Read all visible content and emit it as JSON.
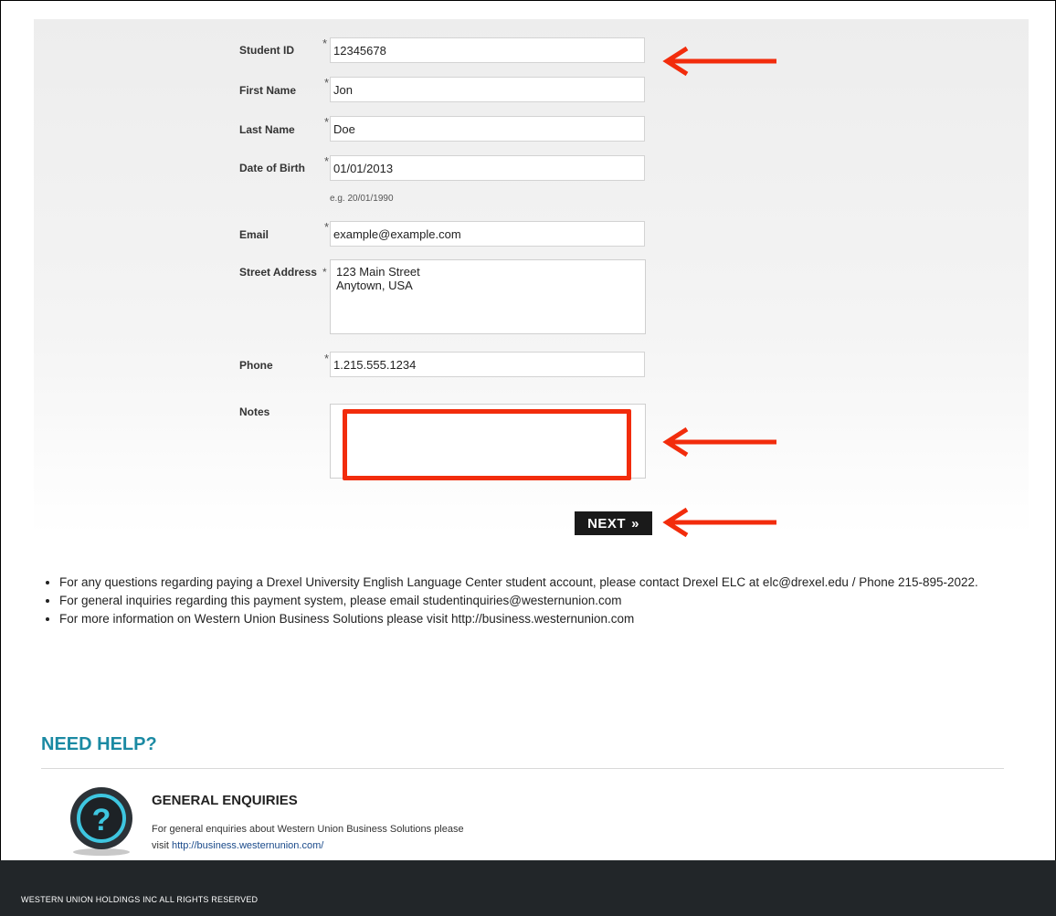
{
  "form": {
    "student_id": {
      "label": "Student ID",
      "value": "12345678"
    },
    "first_name": {
      "label": "First Name",
      "value": "Jon"
    },
    "last_name": {
      "label": "Last Name",
      "value": "Doe"
    },
    "dob": {
      "label": "Date of Birth",
      "value": "01/01/2013",
      "hint": "e.g. 20/01/1990"
    },
    "email": {
      "label": "Email",
      "value": "example@example.com"
    },
    "street": {
      "label": "Street Address",
      "value": "123 Main Street\nAnytown, USA"
    },
    "phone": {
      "label": "Phone",
      "value": "1.215.555.1234"
    },
    "notes": {
      "label": "Notes",
      "value": ""
    },
    "required_mark": "*",
    "next_label": "NEXT",
    "next_chevron": "»"
  },
  "info": [
    "For any questions regarding paying a Drexel University English Language Center student account, please contact Drexel ELC at elc@drexel.edu / Phone 215-895-2022.",
    "For general inquiries regarding this payment system, please email studentinquiries@westernunion.com",
    "For more information on Western Union Business Solutions please visit http://business.westernunion.com"
  ],
  "help": {
    "title": "NEED HELP?",
    "enquiries_title": "GENERAL ENQUIRIES",
    "enquiries_text": "For general enquiries about Western Union Business Solutions please visit ",
    "enquiries_link": "http://business.westernunion.com/"
  },
  "footer": {
    "text": "WESTERN UNION HOLDINGS INC ALL RIGHTS RESERVED"
  },
  "colors": {
    "annotation_red": "#f22c0c",
    "help_teal": "#1b8aa3",
    "footer_bg": "#222629"
  },
  "icons": {
    "help": "question-mark-icon",
    "annotation": "red-arrow-icon"
  }
}
